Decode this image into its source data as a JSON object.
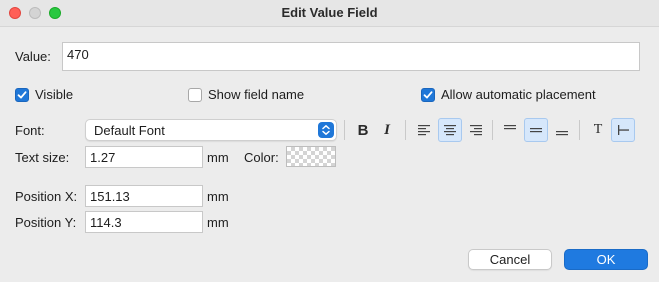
{
  "window": {
    "title": "Edit Value Field"
  },
  "value_field": {
    "label": "Value:",
    "value": "470"
  },
  "options": {
    "visible": {
      "label": "Visible",
      "checked": true
    },
    "show_field_name": {
      "label": "Show field name",
      "checked": false
    },
    "allow_auto_placement": {
      "label": "Allow automatic placement",
      "checked": true
    }
  },
  "font": {
    "label": "Font:",
    "selected": "Default Font"
  },
  "style_toolbar": {
    "bold_glyph": "B",
    "italic_glyph": "I",
    "text_glyph": "T",
    "active": [
      "align-center",
      "valign-middle",
      "text-orientation"
    ]
  },
  "text_size": {
    "label": "Text size:",
    "value": "1.27",
    "unit": "mm"
  },
  "color": {
    "label": "Color:"
  },
  "position_x": {
    "label": "Position X:",
    "value": "151.13",
    "unit": "mm"
  },
  "position_y": {
    "label": "Position Y:",
    "value": "114.3",
    "unit": "mm"
  },
  "buttons": {
    "cancel": "Cancel",
    "ok": "OK"
  },
  "colors": {
    "accent": "#1f77d8",
    "window_bg": "#ececec",
    "toggle_active_bg": "#d6e7fb"
  }
}
